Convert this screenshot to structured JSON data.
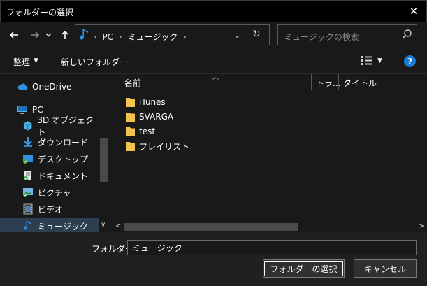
{
  "window": {
    "title": "フォルダーの選択"
  },
  "nav": {
    "breadcrumb": [
      "PC",
      "ミュージック"
    ],
    "search_placeholder": "ミュージックの検索"
  },
  "toolbar": {
    "organize": "整理",
    "new_folder": "新しいフォルダー"
  },
  "sidebar": {
    "items": [
      {
        "label": "OneDrive",
        "icon": "onedrive-cloud-icon"
      },
      {
        "label": "PC",
        "icon": "pc-icon"
      },
      {
        "label": "3D オブジェクト",
        "icon": "3d-objects-icon"
      },
      {
        "label": "ダウンロード",
        "icon": "download-icon"
      },
      {
        "label": "デスクトップ",
        "icon": "desktop-icon"
      },
      {
        "label": "ドキュメント",
        "icon": "documents-icon"
      },
      {
        "label": "ピクチャ",
        "icon": "pictures-icon"
      },
      {
        "label": "ビデオ",
        "icon": "video-icon"
      },
      {
        "label": "ミュージック",
        "icon": "music-icon",
        "selected": true
      }
    ]
  },
  "columns": {
    "name": "名前",
    "track": "トラ...",
    "title": "タイトル"
  },
  "files": [
    {
      "name": "iTunes",
      "type": "folder"
    },
    {
      "name": "SVARGA",
      "type": "folder"
    },
    {
      "name": "test",
      "type": "folder"
    },
    {
      "name": "プレイリスト",
      "type": "folder"
    }
  ],
  "footer": {
    "folder_label": "フォルダー:",
    "folder_value": "ミュージック",
    "select_button": "フォルダーの選択",
    "cancel_button": "キャンセル"
  },
  "colors": {
    "background": "#191919",
    "accent": "#1a7ad4",
    "folder": "#f3c44d"
  }
}
